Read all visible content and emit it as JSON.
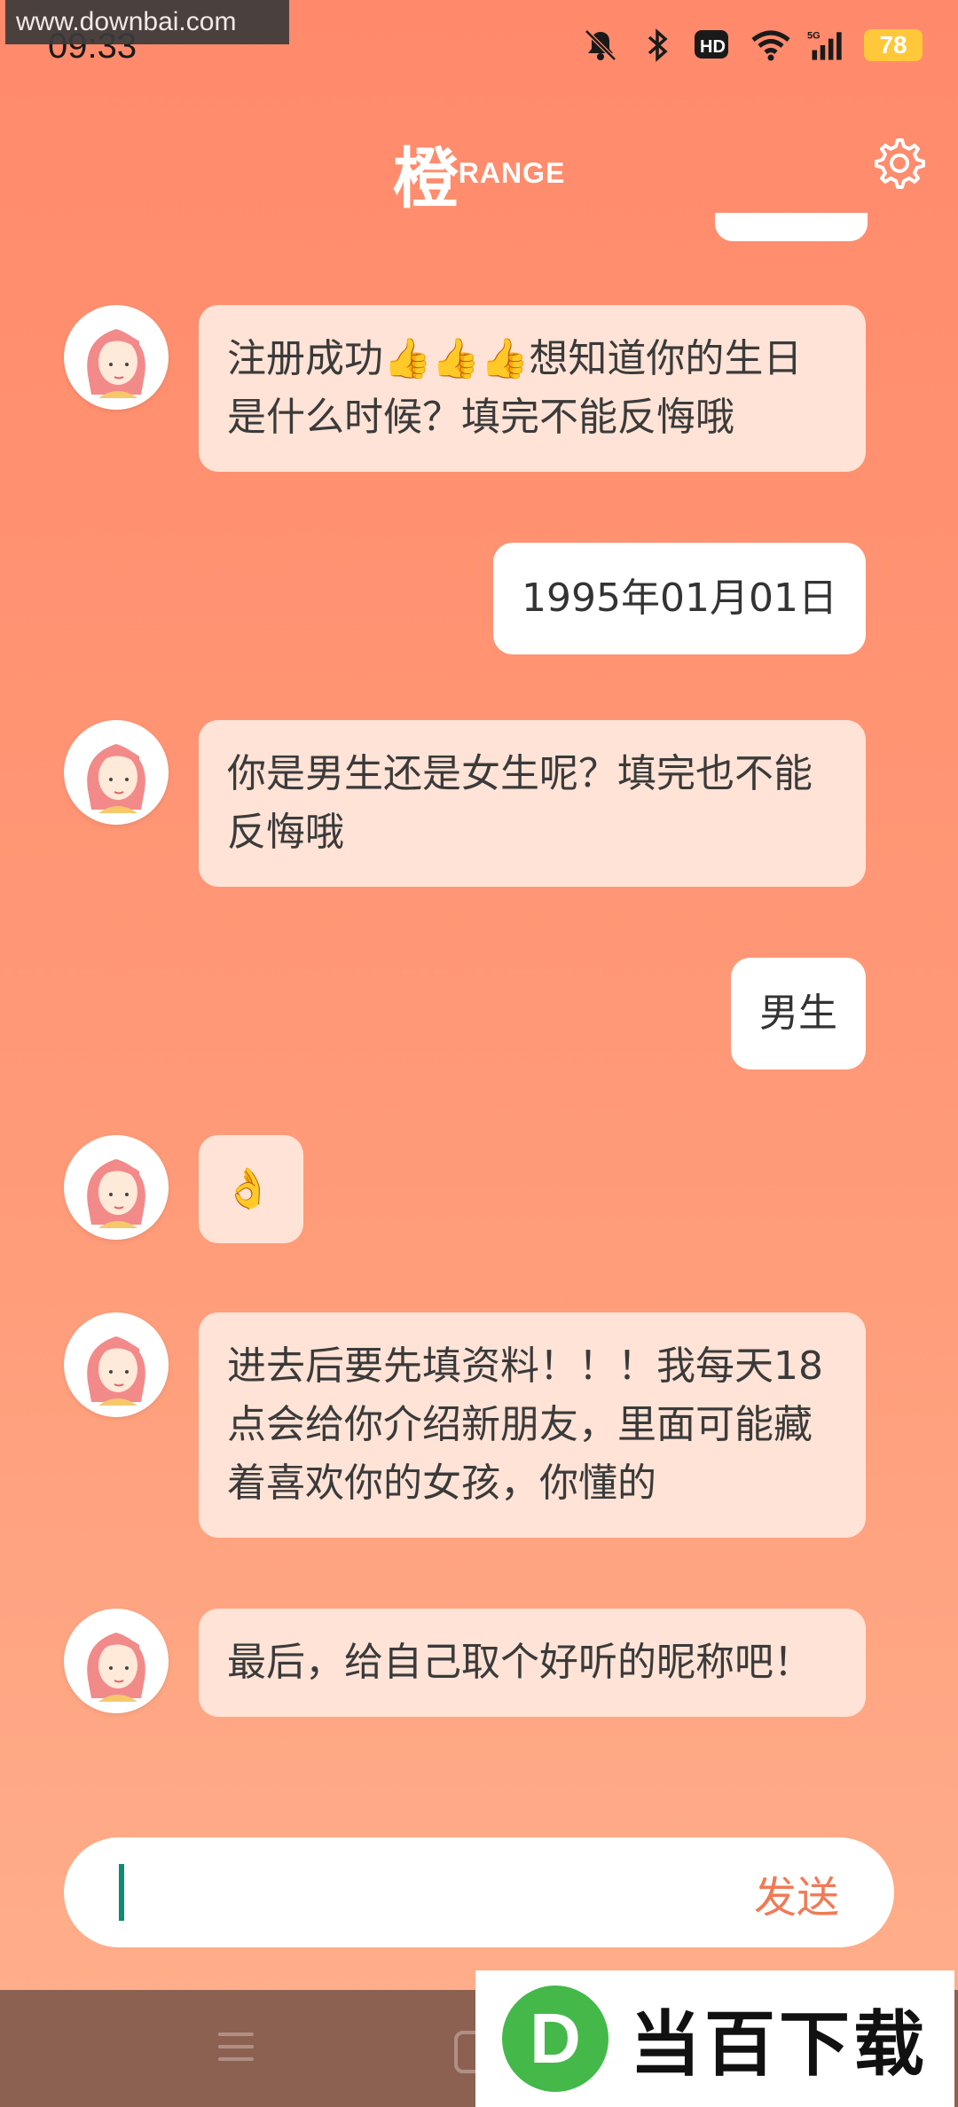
{
  "watermark": "www.downbai.com",
  "status_bar": {
    "time": "09:33",
    "battery": "78"
  },
  "header": {
    "logo_main": "橙",
    "logo_sub": "RANGE"
  },
  "messages": [
    {
      "from": "bot",
      "text": "注册成功👍👍👍想知道你的生日是什么时候？填完不能反悔哦"
    },
    {
      "from": "user",
      "text": "1995年01月01日"
    },
    {
      "from": "bot",
      "text": "你是男生还是女生呢？填完也不能反悔哦"
    },
    {
      "from": "user",
      "text": "男生"
    },
    {
      "from": "bot",
      "text": "👌"
    },
    {
      "from": "bot",
      "text": "进去后要先填资料！！！我每天18点会给你介绍新朋友，里面可能藏着喜欢你的女孩，你懂的"
    },
    {
      "from": "bot",
      "text": "最后，给自己取个好听的昵称吧！"
    }
  ],
  "composer": {
    "send_label": "发送"
  },
  "promo": {
    "logo_letter": "D",
    "text": "当百下载"
  }
}
